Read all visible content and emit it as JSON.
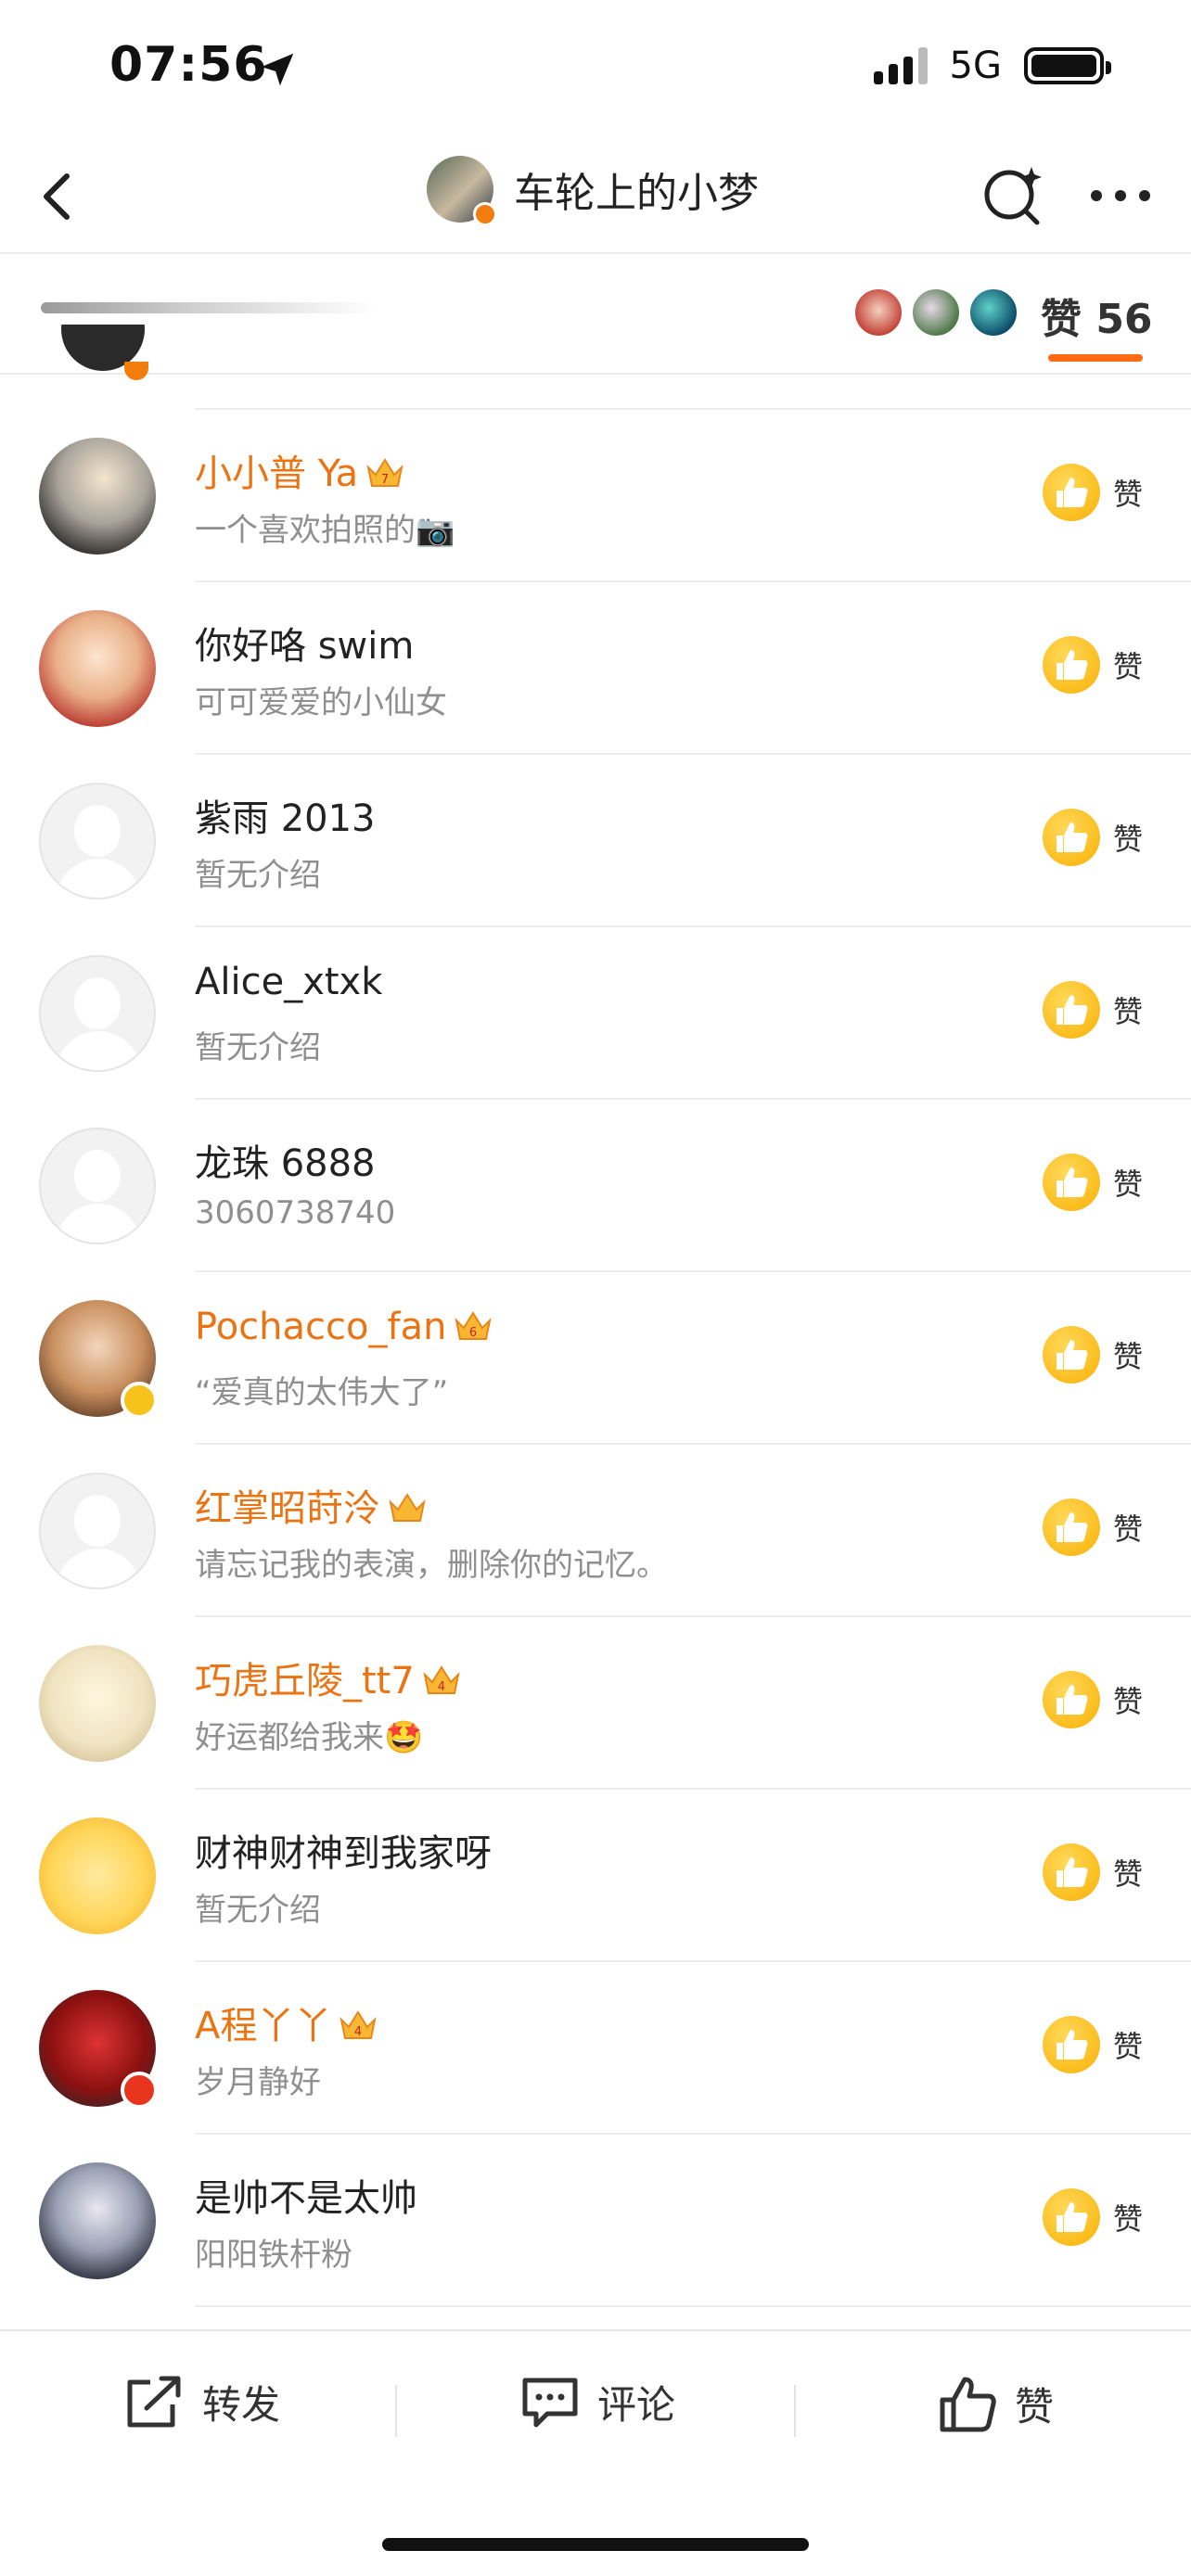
{
  "status_bar": {
    "time": "07:56",
    "network": "5G"
  },
  "header": {
    "title": "车轮上的小梦"
  },
  "tabs": {
    "like_label": "赞 56"
  },
  "likers": [
    {
      "name": "小小普 Ya",
      "bio": "一个喜欢拍照的📷",
      "vip": true,
      "crown_level": "7",
      "avatar_style": "photo-dusk",
      "like_label": "赞"
    },
    {
      "name": "你好咯 swim",
      "bio": "可可爱爱的小仙女",
      "vip": false,
      "avatar_style": "cartoon-girl",
      "like_label": "赞"
    },
    {
      "name": "紫雨 2013",
      "bio": "暂无介绍",
      "vip": false,
      "avatar_style": "default",
      "like_label": "赞"
    },
    {
      "name": "Alice_xtxk",
      "bio": "暂无介绍",
      "vip": false,
      "avatar_style": "default",
      "like_label": "赞"
    },
    {
      "name": "龙珠 6888",
      "bio": "3060738740",
      "vip": false,
      "avatar_style": "default",
      "like_label": "赞"
    },
    {
      "name": "Pochacco_fan",
      "bio": "“爱真的太伟大了”",
      "vip": true,
      "crown_level": "6",
      "avatar_style": "photo-girl",
      "badge": "yellow-v",
      "like_label": "赞"
    },
    {
      "name": "红掌昭莳泠",
      "bio": "请忘记我的表演，删除你的记忆。",
      "vip": true,
      "crown_level": "",
      "avatar_style": "default",
      "like_label": "赞"
    },
    {
      "name": "巧虎丘陵_tt7",
      "bio": "好运都给我来🤩",
      "vip": true,
      "crown_level": "4",
      "avatar_style": "plush-bear",
      "like_label": "赞"
    },
    {
      "name": "财神财神到我家呀",
      "bio": "暂无介绍",
      "vip": false,
      "avatar_style": "yellow-pattern",
      "like_label": "赞"
    },
    {
      "name": "A程丫丫",
      "bio": "岁月静好",
      "vip": true,
      "crown_level": "4",
      "avatar_style": "red-knot",
      "badge": "red-star",
      "like_label": "赞"
    },
    {
      "name": "是帅不是太帅",
      "bio": "阳阳铁杆粉",
      "vip": false,
      "avatar_style": "anime-boy",
      "like_label": "赞"
    }
  ],
  "toolbar": {
    "repost": "转发",
    "comment": "评论",
    "like": "赞"
  },
  "colors": {
    "accent": "#ff6a13",
    "vip_name": "#eb7312",
    "thumb": "#fbbd1e"
  }
}
